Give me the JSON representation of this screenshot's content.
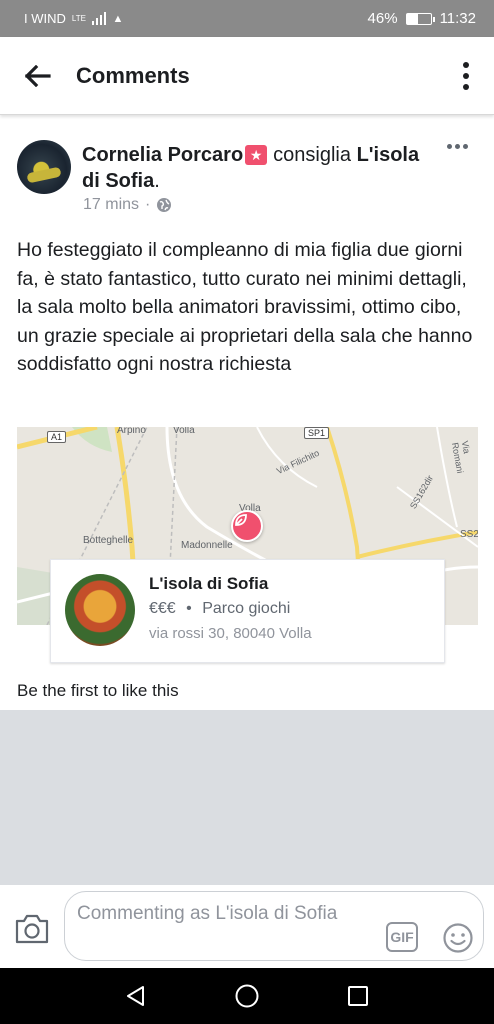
{
  "status_bar": {
    "carrier": "I WIND",
    "network": "LTE",
    "battery_percent": "46%",
    "battery_level": 0.46,
    "time": "11:32"
  },
  "header": {
    "title": "Comments",
    "back_icon": "arrow-left-icon",
    "more_icon": "vertical-dots-icon"
  },
  "post": {
    "author": "Cornelia Porcaro",
    "badge_icon": "recommend-star-icon",
    "verb": "consiglia",
    "page": "L'isola di Sofia",
    "page_suffix": ".",
    "time": "17 mins",
    "separator": "·",
    "privacy_icon": "globe-icon",
    "text": "Ho festeggiato il compleanno di mia figlia due giorni fa, è stato fantastico, tutto curato nei minimi dettagli, la sala molto bella animatori bravissimi, ottimo cibo,  un grazie speciale ai proprietari della sala che hanno soddisfatto ogni nostra richiesta"
  },
  "map": {
    "labels": [
      "A1",
      "Arpino",
      "Volla",
      "SP1",
      "Via Filichito",
      "Botteghelle",
      "Madonnelle",
      "Volla",
      "SS162dir",
      "SS2",
      "Via Romani"
    ]
  },
  "place": {
    "name": "L'isola di Sofia",
    "price": "€€€",
    "dot": "•",
    "category": "Parco giochi",
    "address": "via rossi 30, 80040 Volla"
  },
  "likes_text": "Be the first to like this",
  "composer": {
    "placeholder": "Commenting as L'isola di Sofia",
    "gif_label": "GIF",
    "camera_icon": "camera-icon",
    "emoji_icon": "smiley-icon"
  },
  "nav": {
    "back_icon": "triangle-back-icon",
    "home_icon": "circle-home-icon",
    "recents_icon": "square-recents-icon"
  },
  "colors": {
    "accent_pin": "#f0506e",
    "text_primary": "#1c1e21",
    "text_secondary": "#90949c"
  }
}
